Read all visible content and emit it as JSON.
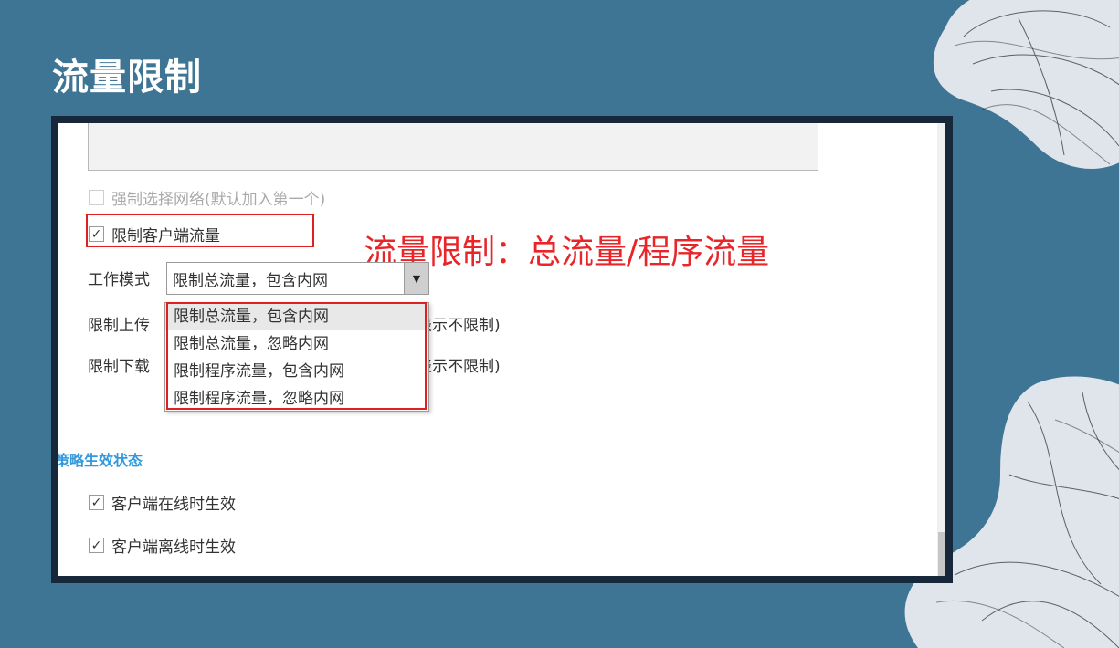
{
  "slide": {
    "title": "流量限制"
  },
  "annotation": {
    "text": "流量限制：总流量/程序流量",
    "color": "#e8262a"
  },
  "form": {
    "force_network": {
      "label": "强制选择网络(默认加入第一个)",
      "checked": false,
      "enabled": false
    },
    "limit_client_traffic": {
      "label": "限制客户端流量",
      "checked": true
    },
    "work_mode": {
      "label": "工作模式",
      "selected": "限制总流量，包含内网",
      "options": [
        "限制总流量，包含内网",
        "限制总流量，忽略内网",
        "限制程序流量，包含内网",
        "限制程序流量，忽略内网"
      ]
    },
    "upload_limit": {
      "label": "限制上传",
      "hint_fragment": "表示不限制)"
    },
    "download_limit": {
      "label": "限制下载",
      "hint_fragment": "表示不限制)"
    },
    "policy_status": {
      "title": "策略生效状态",
      "online": {
        "label": "客户端在线时生效",
        "checked": true
      },
      "offline": {
        "label": "客户端离线时生效",
        "checked": true
      }
    }
  },
  "icons": {
    "check": "✓",
    "dropdown_arrow": "▼"
  }
}
